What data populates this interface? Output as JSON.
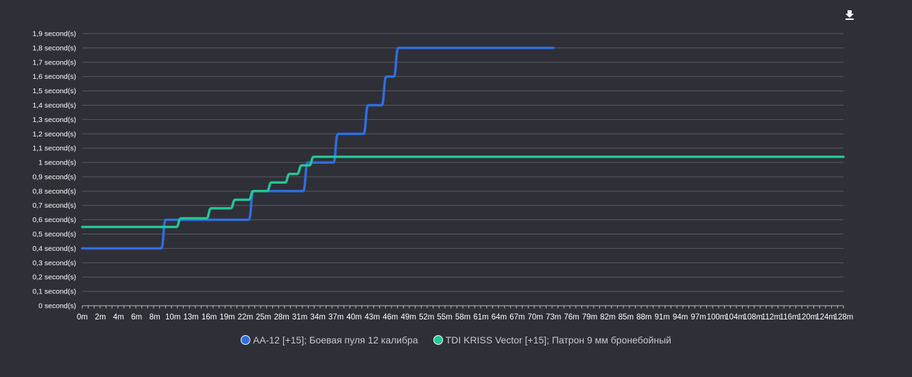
{
  "chart_data": {
    "type": "line",
    "title": "",
    "xlabel": "",
    "ylabel": "",
    "ylim": [
      0,
      1.9
    ],
    "xlim": [
      0,
      128
    ],
    "grid": true,
    "legend": "bottom-center",
    "y_ticks": [
      0,
      0.1,
      0.2,
      0.3,
      0.4,
      0.5,
      0.6,
      0.7,
      0.8,
      0.9,
      1.0,
      1.1,
      1.2,
      1.3,
      1.4,
      1.5,
      1.6,
      1.7,
      1.8,
      1.9
    ],
    "y_tick_labels": [
      "0 second(s)",
      "0,1 second(s)",
      "0,2 second(s)",
      "0,3 second(s)",
      "0,4 second(s)",
      "0,5 second(s)",
      "0,6 second(s)",
      "0,7 second(s)",
      "0,8 second(s)",
      "0,9 second(s)",
      "1 second(s)",
      "1,1 second(s)",
      "1,2 second(s)",
      "1,3 second(s)",
      "1,4 second(s)",
      "1,5 second(s)",
      "1,6 second(s)",
      "1,7 second(s)",
      "1,8 second(s)",
      "1,9 second(s)"
    ],
    "x_tick_labels": [
      "0m",
      "2m",
      "4m",
      "6m",
      "8m",
      "10m",
      "13m",
      "16m",
      "19m",
      "22m",
      "25m",
      "28m",
      "31m",
      "34m",
      "37m",
      "40m",
      "43m",
      "46m",
      "49m",
      "52m",
      "55m",
      "58m",
      "61m",
      "64m",
      "67m",
      "70m",
      "73m",
      "76m",
      "79m",
      "82m",
      "85m",
      "88m",
      "91m",
      "94m",
      "97m",
      "100m",
      "104m",
      "108m",
      "112m",
      "116m",
      "120m",
      "124m",
      "128m"
    ],
    "series": [
      {
        "name": "AA-12 [+15]; Боевая пуля 12 калибра",
        "color": "#2f6fe0",
        "steps": [
          [
            0,
            0.4
          ],
          [
            9,
            0.6
          ],
          [
            23,
            0.8
          ],
          [
            32,
            1.0
          ],
          [
            37,
            1.2
          ],
          [
            42,
            1.4
          ],
          [
            45,
            1.6
          ],
          [
            47,
            1.8
          ],
          [
            73,
            1.8
          ]
        ]
      },
      {
        "name": "TDI KRISS Vector [+15]; Патрон 9 мм бронебойный",
        "color": "#21c994",
        "steps": [
          [
            0,
            0.55
          ],
          [
            11,
            0.61
          ],
          [
            16,
            0.68
          ],
          [
            20,
            0.74
          ],
          [
            23,
            0.8
          ],
          [
            26,
            0.86
          ],
          [
            29,
            0.92
          ],
          [
            31,
            0.98
          ],
          [
            33,
            1.04
          ],
          [
            128,
            1.04
          ]
        ]
      }
    ]
  },
  "toolbar": {
    "download_icon": "download-icon"
  }
}
